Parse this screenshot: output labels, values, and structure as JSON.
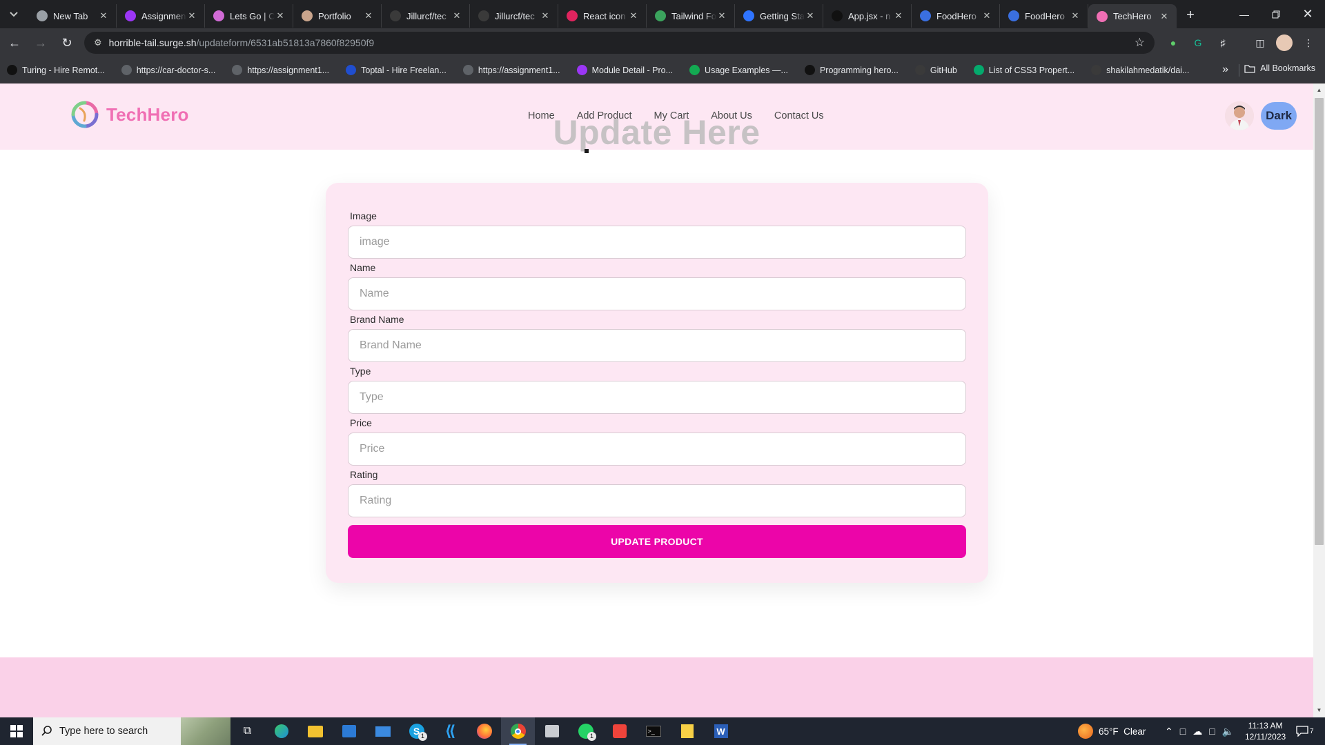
{
  "browser": {
    "tabs": [
      {
        "title": "New Tab",
        "icon": "chrome-icon",
        "color": "#9aa0a6"
      },
      {
        "title": "Assignment",
        "icon": "video-icon",
        "color": "#9b36f5"
      },
      {
        "title": "Lets Go | C",
        "icon": "tag-icon",
        "color": "#d16bd6"
      },
      {
        "title": "Portfolio",
        "icon": "avatar-icon",
        "color": "#c9a48c"
      },
      {
        "title": "Jillurcf/tec",
        "icon": "github-icon",
        "color": "#3a3a3a"
      },
      {
        "title": "Jillurcf/tec",
        "icon": "github-icon",
        "color": "#3a3a3a"
      },
      {
        "title": "React icon",
        "icon": "react-icons-icon",
        "color": "#e0245e"
      },
      {
        "title": "Tailwind Fo",
        "icon": "tailwind-icon",
        "color": "#3ba35d"
      },
      {
        "title": "Getting Sta",
        "icon": "docs-icon",
        "color": "#2f74ff"
      },
      {
        "title": "App.jsx - n",
        "icon": "codesandbox-icon",
        "color": "#111111"
      },
      {
        "title": "FoodHero",
        "icon": "vercel-icon",
        "color": "#3a6fe0"
      },
      {
        "title": "FoodHero",
        "icon": "vercel-icon",
        "color": "#3a6fe0"
      },
      {
        "title": "TechHero",
        "icon": "techhero-icon",
        "color": "#f06fb4"
      }
    ],
    "url_host": "horrible-tail.surge.sh",
    "url_path": "/updateform/6531ab51813a7860f82950f9",
    "bookmarks": [
      {
        "label": "Turing - Hire Remot...",
        "color": "#111111"
      },
      {
        "label": "https://car-doctor-s...",
        "color": "#5f6368"
      },
      {
        "label": "https://assignment1...",
        "color": "#5f6368"
      },
      {
        "label": "Toptal - Hire Freelan...",
        "color": "#204ecf"
      },
      {
        "label": "https://assignment1...",
        "color": "#5f6368"
      },
      {
        "label": "Module Detail - Pro...",
        "color": "#9b36f5"
      },
      {
        "label": "Usage Examples —...",
        "color": "#13aa52"
      },
      {
        "label": "Programming hero...",
        "color": "#111111"
      },
      {
        "label": "GitHub",
        "color": "#3a3a3a"
      },
      {
        "label": "List of CSS3 Propert...",
        "color": "#04aa6d"
      },
      {
        "label": "shakilahmedatik/dai...",
        "color": "#3a3a3a"
      }
    ],
    "all_bookmarks_label": "All Bookmarks"
  },
  "site": {
    "brand": "TechHero",
    "nav": [
      "Home",
      "Add Product",
      "My Cart",
      "About Us",
      "Contact Us"
    ],
    "theme_button": "Dark",
    "heading": "Update Here",
    "form": {
      "fields": [
        {
          "label": "Image",
          "placeholder": "image"
        },
        {
          "label": "Name",
          "placeholder": "Name"
        },
        {
          "label": "Brand Name",
          "placeholder": "Brand Name"
        },
        {
          "label": "Type",
          "placeholder": "Type"
        },
        {
          "label": "Price",
          "placeholder": "Price"
        },
        {
          "label": "Rating",
          "placeholder": "Rating"
        }
      ],
      "submit": "UPDATE PRODUCT"
    },
    "colors": {
      "accent": "#ec05a9",
      "brand": "#f06fb4",
      "nav_bg": "#fde7f3",
      "footer_bg": "#fad1e8"
    }
  },
  "taskbar": {
    "search_placeholder": "Type here to search",
    "weather": "65°F  Clear",
    "time": "11:13 AM",
    "date": "12/11/2023",
    "notification_count": "7",
    "skype_badge": "1",
    "whatsapp_badge": "1"
  }
}
